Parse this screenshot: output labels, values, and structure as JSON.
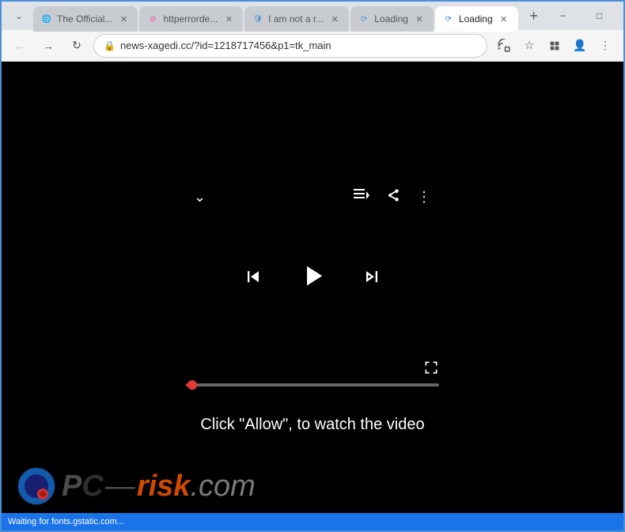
{
  "browser": {
    "tabs": [
      {
        "id": "tab1",
        "label": "The Official...",
        "favicon": "🌐",
        "active": false,
        "closable": true
      },
      {
        "id": "tab2",
        "label": "httperrorde...",
        "favicon": "⚠",
        "active": false,
        "closable": true
      },
      {
        "id": "tab3",
        "label": "I am not a r...",
        "favicon": "🛡",
        "active": false,
        "closable": true
      },
      {
        "id": "tab4",
        "label": "Loading",
        "favicon": "🔄",
        "active": false,
        "closable": true
      },
      {
        "id": "tab5",
        "label": "Loading",
        "favicon": "🔄",
        "active": true,
        "closable": true
      }
    ],
    "new_tab_label": "+",
    "window_controls": {
      "minimize": "−",
      "maximize": "□",
      "close": "✕"
    },
    "nav": {
      "back": "←",
      "forward": "→",
      "reload": "↻",
      "address": "news-xagedi.cc/?id=1218717456&p1=tk_main",
      "lock_icon": "🔒"
    }
  },
  "player": {
    "chevron_down": "⌄",
    "queue_icon": "≡",
    "share_icon": "↪",
    "more_icon": "⋮",
    "prev_icon": "⏮",
    "play_icon": "▶",
    "next_icon": "⏭",
    "fullscreen_icon": "⛶",
    "progress_percent": 2,
    "click_allow_text": "Click \"Allow\", to watch the video"
  },
  "watermark": {
    "slash": "P",
    "c": "C",
    "dash": "—",
    "risk": "risk",
    "com": ".com"
  },
  "status_bar": {
    "text": "Waiting for fonts.gstatic.com..."
  }
}
